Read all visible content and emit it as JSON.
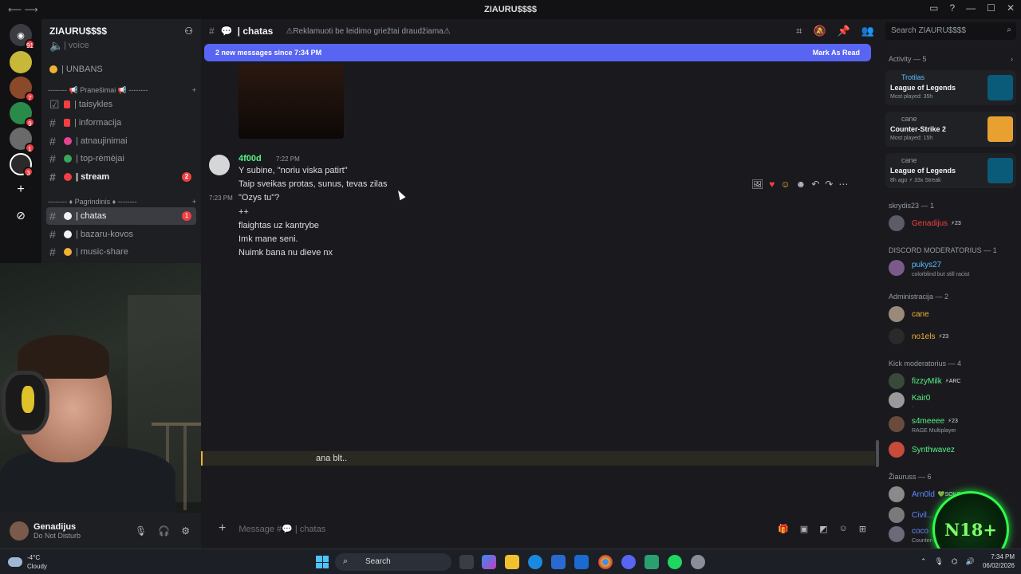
{
  "window": {
    "title": "ZIAURU$$$$"
  },
  "servers": [
    {
      "badge": "91",
      "color": "#3a3c42",
      "icon": "discord-home-icon"
    },
    {
      "badge": "",
      "color": "#c8b83a",
      "icon": "server-icon"
    },
    {
      "badge": "7",
      "color": "#8a4a2a",
      "icon": "server-icon"
    },
    {
      "badge": "9",
      "color": "#2a8a4a",
      "icon": "server-icon"
    },
    {
      "badge": "1",
      "color": "#6a6a6a",
      "icon": "server-icon"
    },
    {
      "badge": "3",
      "color": "#2a2a2a",
      "icon": "server-icon"
    }
  ],
  "guild": {
    "name": "ZIAURU$$$$"
  },
  "channels": {
    "voice_partial": "| voice",
    "unbans": "| UNBANS",
    "cat1": "Pranešimai",
    "taisykles": "| taisykles",
    "informacija": "| informacija",
    "atnaujinimai": "| atnaujinimai",
    "top_remejai": "| top-rėmėjai",
    "stream": "| stream",
    "stream_badge": "2",
    "cat2": "Pagrindinis",
    "chatas": "| chatas",
    "chatas_badge": "1",
    "bazaru": "| bazaru-kovos",
    "music": "| music-share"
  },
  "user": {
    "name": "Genadijus",
    "status": "Do Not Disturb"
  },
  "header": {
    "channel": "| chatas",
    "topic": "⚠Reklamuoti be leidimo griežtai draudžiama⚠"
  },
  "newbar": {
    "text": "2 new messages since 7:34 PM",
    "action": "Mark As Read"
  },
  "message": {
    "author": "4f00d",
    "time": "7:22 PM",
    "side_time": "7:23 PM",
    "lines": [
      "Y subine, \"noriu viska patirt\"",
      "Taip sveikas protas, sunus, tevas zilas",
      "\"Ozys tu\"?",
      "++",
      "flaightas uz kantrybe",
      "Imk mane seni.",
      "Nuimk bana nu dieve nx"
    ]
  },
  "highlight_text": "ana blt..",
  "composer": {
    "placeholder": "Message #💬 | chatas"
  },
  "members": {
    "search_placeholder": "Search ZIAURU$$$$",
    "activity_title": "Activity — 5",
    "activities": [
      {
        "user": "Trotilas",
        "game": "League of Legends",
        "extra": "Most played: 35h",
        "color": "#0a5a7a"
      },
      {
        "user": "cane",
        "game": "Counter-Strike 2",
        "extra": "Most played: 15h",
        "color": "#e8a030"
      },
      {
        "user": "cane",
        "game": "League of Legends",
        "extra": "8h ago  ⚡ 33x Streak",
        "color": "#0a5a7a"
      }
    ],
    "groups": [
      {
        "title": "skrydis23 — 1"
      },
      {
        "title": "DISCORD MODERATORIUS — 1"
      },
      {
        "title": "Administracija — 2"
      },
      {
        "title": "Kick moderatorius — 4"
      },
      {
        "title": "Žiauruss — 6"
      }
    ],
    "list": [
      {
        "name": "Genadijus",
        "tag": "⚡23",
        "sub": "",
        "color": "#f23f43"
      },
      {
        "name": "pukys27",
        "tag": "",
        "sub": "colorblind but still racist",
        "color": "#5bbcff"
      },
      {
        "name": "cane",
        "tag": "",
        "sub": "",
        "color": "#f0b232"
      },
      {
        "name": "no1els",
        "tag": "⚡23",
        "sub": "",
        "color": "#f0b232"
      },
      {
        "name": "fizzyMilk",
        "tag": "⚡ARC",
        "sub": "",
        "color": "#57f287"
      },
      {
        "name": "Kair0",
        "tag": "",
        "sub": "·",
        "color": "#57f287"
      },
      {
        "name": "s4meeee",
        "tag": "⚡23",
        "sub": "RAGE Multiplayer",
        "color": "#57f287"
      },
      {
        "name": "Synthwavez",
        "tag": "",
        "sub": "",
        "color": "#57f287"
      },
      {
        "name": "Arn0ld",
        "tag": "💚SOKO",
        "sub": "",
        "color": "#5b8aff"
      },
      {
        "name": "Civil...",
        "tag": "",
        "sub": "",
        "color": "#5b8aff"
      },
      {
        "name": "coco",
        "tag": "",
        "sub": "Counter-Strike 2",
        "color": "#5b8aff"
      }
    ]
  },
  "overlay": {
    "badge": "N18+"
  },
  "taskbar": {
    "temp": "-4°C",
    "weather": "Cloudy",
    "search": "Search",
    "time": "7:34 PM",
    "date": "06/02/2026"
  }
}
